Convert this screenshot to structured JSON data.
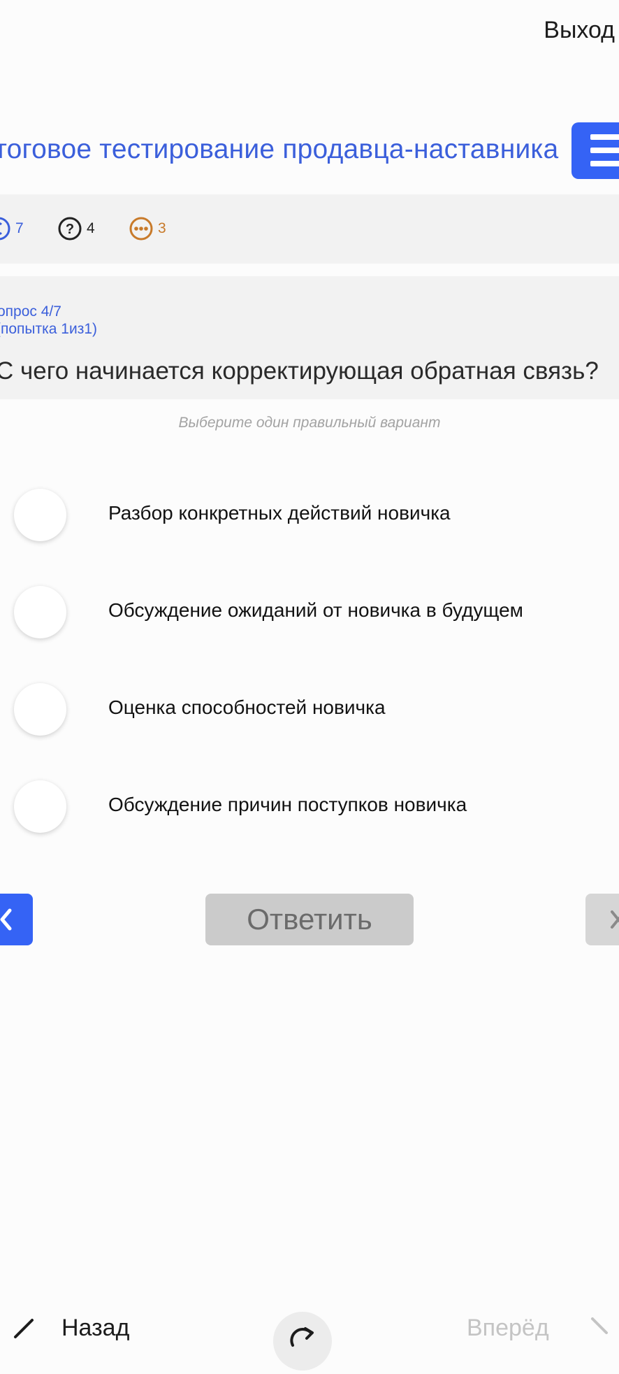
{
  "header": {
    "exit_label": "Выход",
    "title": "тоговое тестирование продавца-наставника"
  },
  "stats": {
    "answered": "7",
    "unanswered": "4",
    "skipped": "3",
    "colors": {
      "answered": "#3b5fdb",
      "unanswered": "#222222",
      "skipped": "#c87a2a"
    }
  },
  "question": {
    "number": "опрос 4/7",
    "attempt": "(попытка 1из1)",
    "text": "С чего начинается корректирующая обратная связь?",
    "hint": "Выберите один правильный вариант"
  },
  "options": [
    {
      "label": "Разбор конкретных действий новичка"
    },
    {
      "label": "Обсуждение ожиданий от новичка в будущем"
    },
    {
      "label": "Оценка способностей новичка"
    },
    {
      "label": "Обсуждение причин поступков новичка"
    }
  ],
  "controls": {
    "answer_label": "Ответить"
  },
  "bottom_nav": {
    "back_label": "Назад",
    "forward_label": "Вперёд"
  },
  "colors": {
    "accent": "#3563f5",
    "title": "#3b5fdb",
    "disabled_button": "#cbcbcb"
  }
}
